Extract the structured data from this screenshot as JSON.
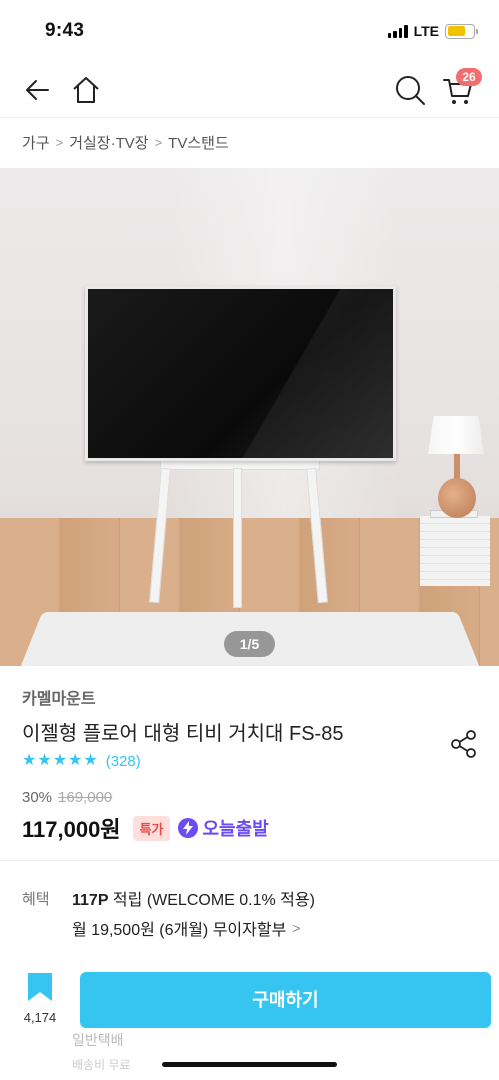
{
  "status_bar": {
    "time": "9:43",
    "network": "LTE"
  },
  "nav": {
    "cart_count": "26"
  },
  "breadcrumb": [
    "가구",
    "거실장·TV장",
    "TV스탠드"
  ],
  "gallery": {
    "pager": "1/5"
  },
  "product": {
    "brand": "카멜마운트",
    "title": "이젤형 플로어 대형 티비 거치대 FS-85",
    "rating_stars": 5,
    "review_count": "(328)",
    "discount": "30%",
    "original_price": "169,000",
    "price": "117,000원",
    "special_tag": "특가",
    "delivery_badge": "오늘출발"
  },
  "benefit": {
    "label": "혜택",
    "points": "117P",
    "points_text": " 적립 (WELCOME 0.1% 적용)",
    "installment": "월 19,500원 (6개월) 무이자할부"
  },
  "faded_lines": {
    "shipping": "일반택배",
    "detail": "배송비 무료"
  },
  "bottom_bar": {
    "bookmark_count": "4,174",
    "buy_label": "구매하기"
  },
  "colors": {
    "accent": "#35c5f0",
    "badge_red": "#f26d6d",
    "today_purple": "#6b4bf5",
    "special_bg": "#ffdedc"
  }
}
